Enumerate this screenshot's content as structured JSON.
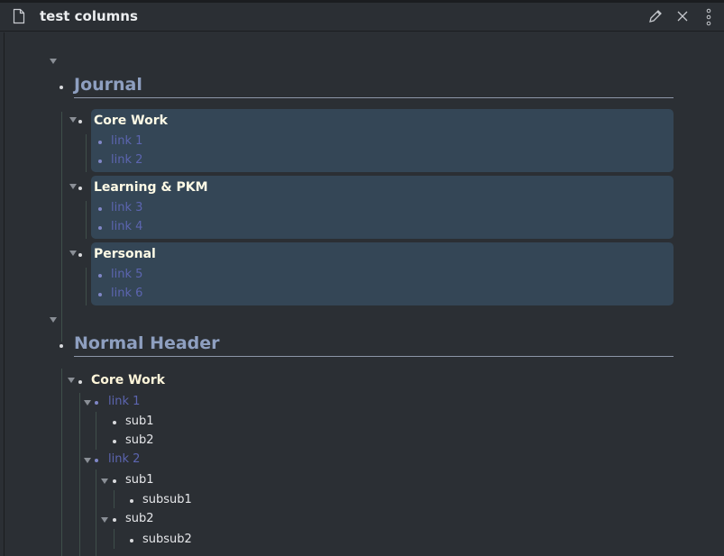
{
  "window": {
    "title": "test columns",
    "icons": [
      "file-icon",
      "edit-icon",
      "close-icon",
      "more-icon"
    ]
  },
  "journal_section": {
    "header": "Journal",
    "cards": [
      {
        "title": "Core Work",
        "links": [
          "link 1",
          "link 2"
        ]
      },
      {
        "title": "Learning & PKM",
        "links": [
          "link 3",
          "link 4"
        ]
      },
      {
        "title": "Personal",
        "links": [
          "link 5",
          "link 6"
        ]
      }
    ]
  },
  "normal_section": {
    "header": "Normal Header",
    "group_title": "Core Work",
    "link1": {
      "label": "link 1",
      "children": [
        "sub1",
        "sub2"
      ]
    },
    "link2": {
      "label": "link 2",
      "sub1": {
        "label": "sub1",
        "child": "subsub1"
      },
      "sub2": {
        "label": "sub2",
        "child": "subsub2"
      }
    }
  },
  "colors": {
    "background": "#2b2f34",
    "card": "#344656",
    "heading": "#8e9fc0",
    "link": "#5c65b0",
    "card_title": "#fffbe6"
  }
}
